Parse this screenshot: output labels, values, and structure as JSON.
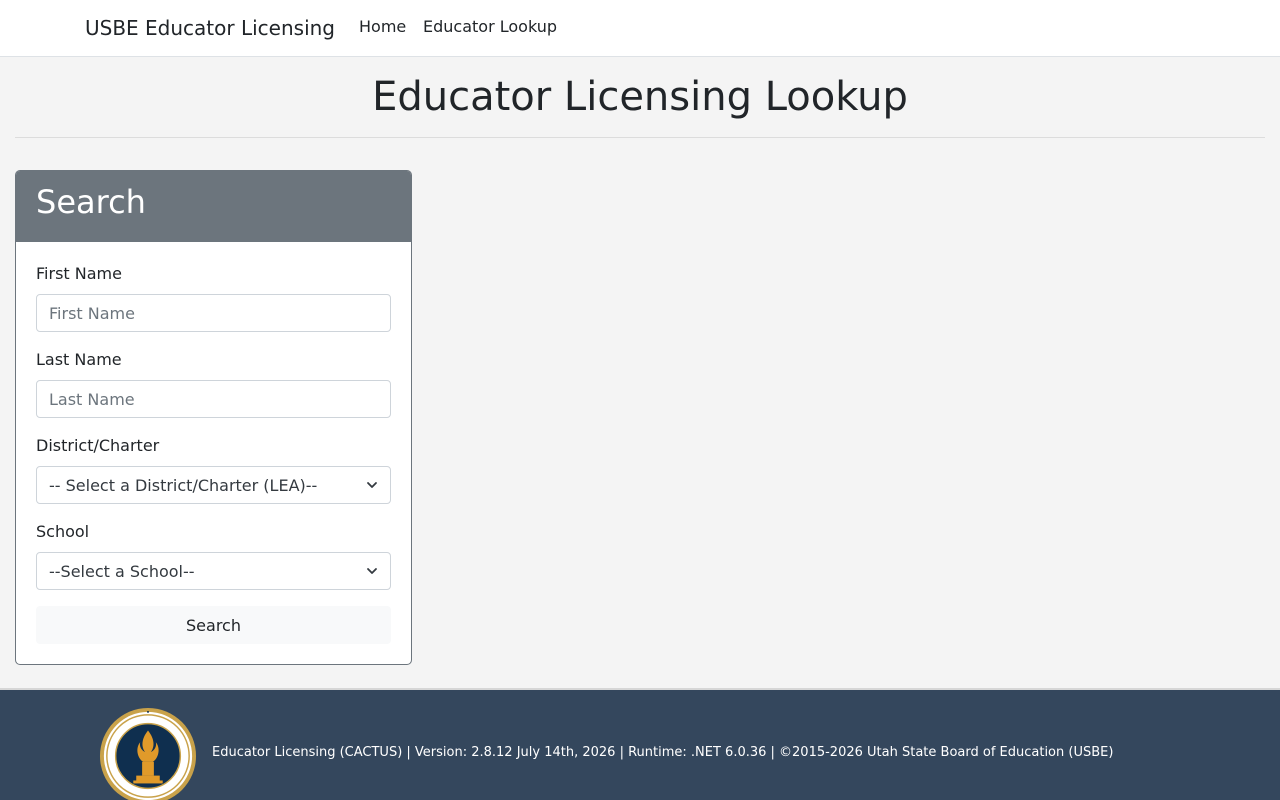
{
  "navbar": {
    "brand": "USBE Educator Licensing",
    "links": [
      {
        "label": "Home"
      },
      {
        "label": "Educator Lookup"
      }
    ]
  },
  "page": {
    "title": "Educator Licensing Lookup"
  },
  "search_card": {
    "header": "Search",
    "first_name": {
      "label": "First Name",
      "placeholder": "First Name",
      "value": ""
    },
    "last_name": {
      "label": "Last Name",
      "placeholder": "Last Name",
      "value": ""
    },
    "district": {
      "label": "District/Charter",
      "selected": "-- Select a District/Charter (LEA)--"
    },
    "school": {
      "label": "School",
      "selected": "--Select a School--"
    },
    "submit_label": "Search"
  },
  "footer": {
    "text": "Educator Licensing (CACTUS) | Version: 2.8.12 July 14th, 2026 | Runtime: .NET 6.0.36 | ©2015-2026 Utah State Board of Education (USBE)",
    "seal_icon": "usbe-seal-icon"
  },
  "colors": {
    "card_header": "#6c757d",
    "footer_bg": "#34475d",
    "page_bg": "#f4f4f4"
  }
}
